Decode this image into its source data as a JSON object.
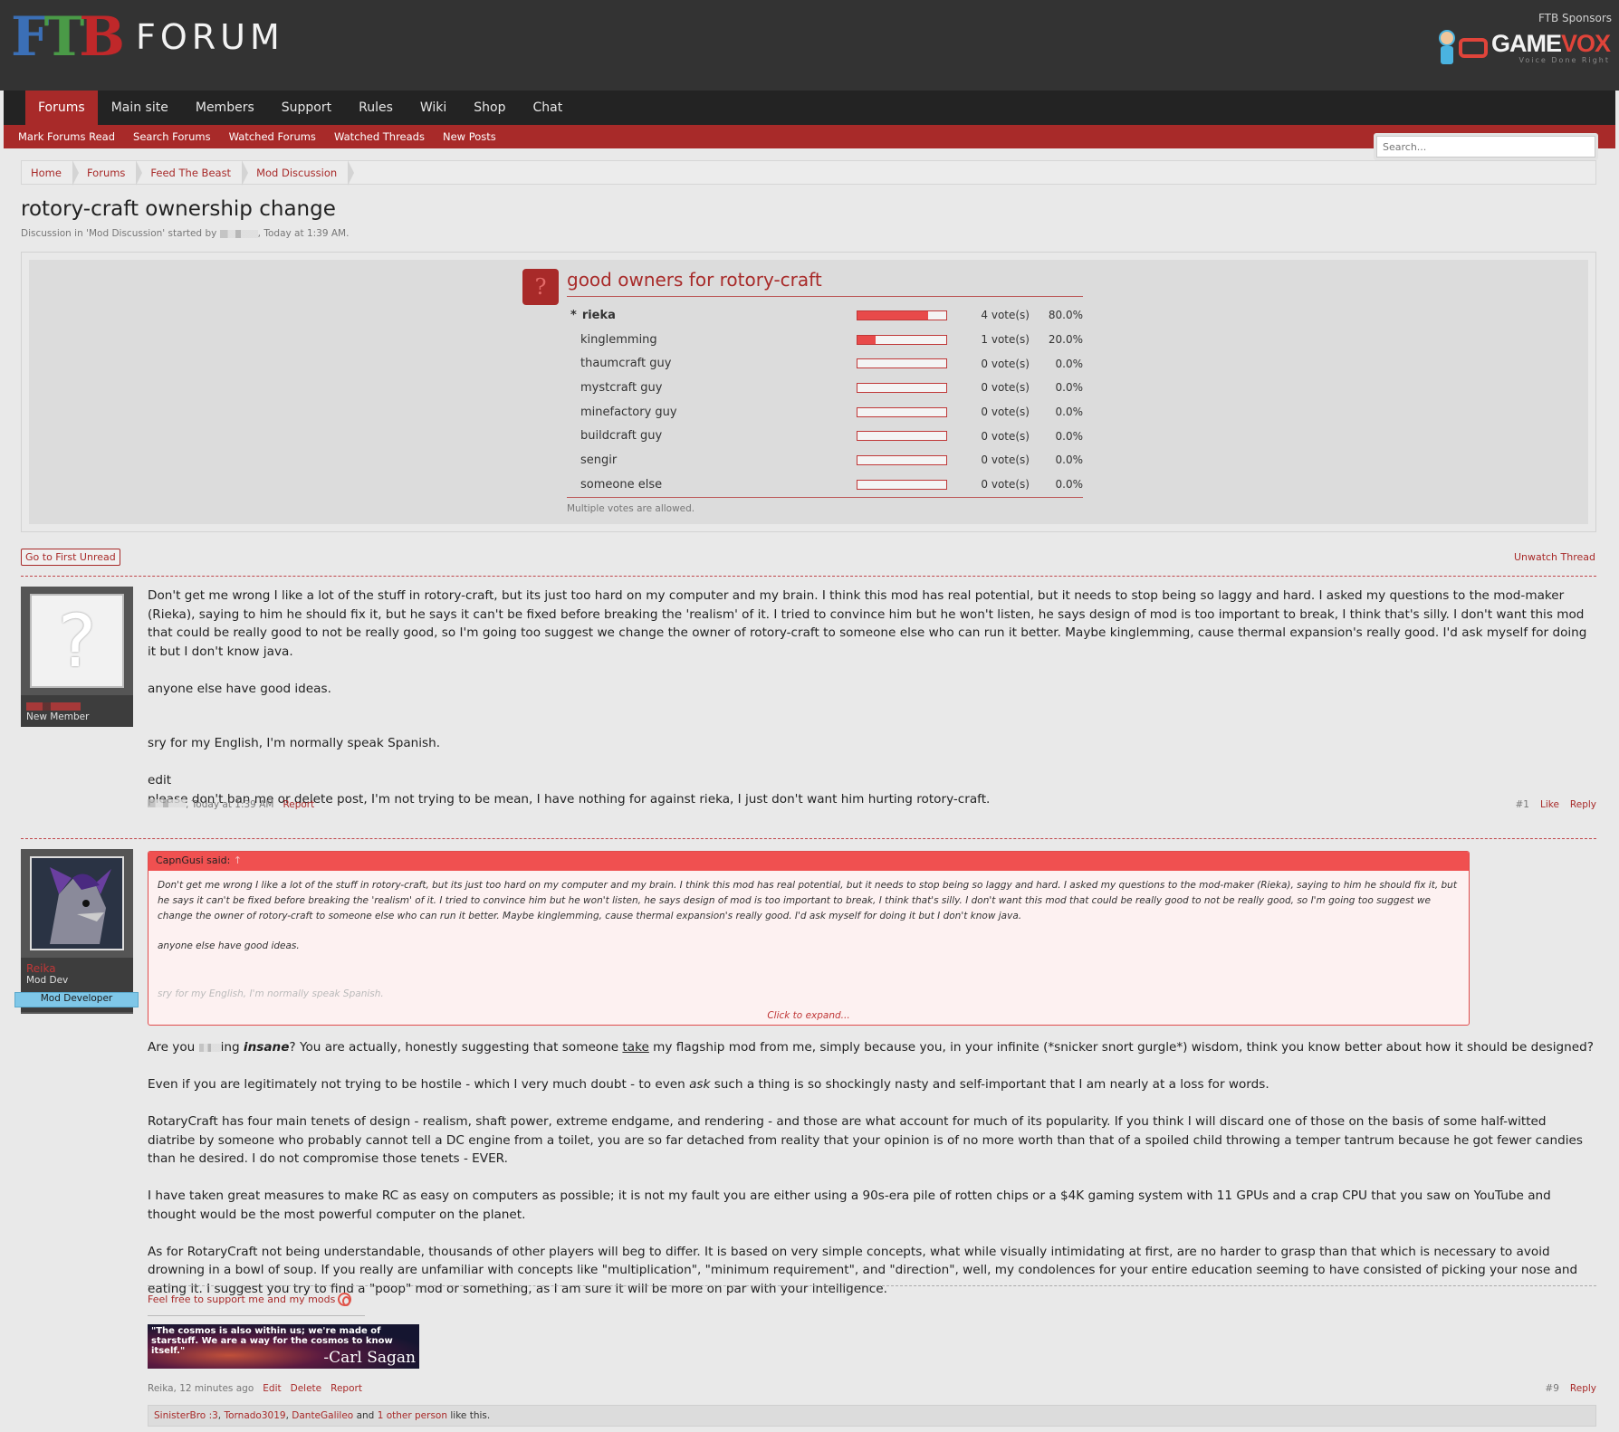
{
  "header": {
    "logo_mark": [
      "F",
      "T",
      "B"
    ],
    "logo_text": "FORUM",
    "sponsors_label": "FTB Sponsors",
    "sponsor_name_a": "GAME",
    "sponsor_name_b": "VOX",
    "sponsor_tagline": "Voice Done Right"
  },
  "nav": {
    "tabs": [
      "Forums",
      "Main site",
      "Members",
      "Support",
      "Rules",
      "Wiki",
      "Shop",
      "Chat"
    ],
    "active": "Forums",
    "sublinks": [
      "Mark Forums Read",
      "Search Forums",
      "Watched Forums",
      "Watched Threads",
      "New Posts"
    ],
    "search_placeholder": "Search..."
  },
  "breadcrumb": [
    "Home",
    "Forums",
    "Feed The Beast",
    "Mod Discussion"
  ],
  "thread": {
    "title": "rotory-craft ownership change",
    "meta_prefix": "Discussion in 'Mod Discussion' started by",
    "meta_suffix": ", Today at 1:39 AM."
  },
  "poll": {
    "question": "good owners for rotory-craft",
    "icon": "?",
    "options": [
      {
        "label": "rieka",
        "votes": "4 vote(s)",
        "percent": "80.0%",
        "fill": 0.8,
        "voted": true,
        "marker": "*"
      },
      {
        "label": "kinglemming",
        "votes": "1 vote(s)",
        "percent": "20.0%",
        "fill": 0.2,
        "voted": false
      },
      {
        "label": "thaumcraft guy",
        "votes": "0 vote(s)",
        "percent": "0.0%",
        "fill": 0,
        "voted": false
      },
      {
        "label": "mystcraft guy",
        "votes": "0 vote(s)",
        "percent": "0.0%",
        "fill": 0,
        "voted": false
      },
      {
        "label": "minefactory guy",
        "votes": "0 vote(s)",
        "percent": "0.0%",
        "fill": 0,
        "voted": false
      },
      {
        "label": "buildcraft guy",
        "votes": "0 vote(s)",
        "percent": "0.0%",
        "fill": 0,
        "voted": false
      },
      {
        "label": "sengir",
        "votes": "0 vote(s)",
        "percent": "0.0%",
        "fill": 0,
        "voted": false
      },
      {
        "label": "someone else",
        "votes": "0 vote(s)",
        "percent": "0.0%",
        "fill": 0,
        "voted": false
      }
    ],
    "footer": "Multiple votes are allowed."
  },
  "controls": {
    "first_unread": "Go to First Unread",
    "unwatch": "Unwatch Thread"
  },
  "post1": {
    "user_title": "New Member",
    "paragraphs": [
      "Don't get me wrong I like a lot of the stuff in rotory-craft, but its just too hard on my computer and my brain. I think this mod has real potential, but it needs to stop being so laggy and hard. I asked my questions to the mod-maker (Rieka), saying to him he should fix it, but he says it can't be fixed before breaking the 'realism' of it. I tried to convince him but he won't listen, he says design of mod is too important to break, I think that's silly. I don't want this mod that could be really good to not be really good, so I'm going too suggest we change the owner of rotory-craft to someone else who can run it better. Maybe kinglemming, cause thermal expansion's really good. I'd ask myself for doing it but I don't know java.",
      "anyone else have good ideas.",
      "sry for my English, I'm normally speak Spanish.",
      "edit",
      "please don't ban me or delete post, I'm not trying to be mean, I have nothing for against rieka, I just don't want him hurting rotory-craft."
    ],
    "time": ", Today at 1:39 AM",
    "report": "Report",
    "number": "#1",
    "like": "Like",
    "reply": "Reply"
  },
  "post2": {
    "username": "Reika",
    "user_title": "Mod Dev",
    "banner": "Mod Developer",
    "quote_author": "CapnGusi said:",
    "quote_arrow": "↑",
    "quote_paragraphs": [
      "Don't get me wrong I like a lot of the stuff in rotory-craft, but its just too hard on my computer and my brain. I think this mod has real potential, but it needs to stop being so laggy and hard. I asked my questions to the mod-maker (Rieka), saying to him he should fix it, but he says it can't be fixed before breaking the 'realism' of it. I tried to convince him but he won't listen, he says design of mod is too important to break, I think that's silly. I don't want this mod that could be really good to not be really good, so I'm going too suggest we change the owner of rotory-craft to someone else who can run it better. Maybe kinglemming, cause thermal expansion's really good. I'd ask myself for doing it but I don't know java.",
      "anyone else have good ideas.",
      "sry for my English, I'm normally speak Spanish."
    ],
    "quote_expand": "Click to expand...",
    "p1_a": "Are you ",
    "p1_b": "ing ",
    "p1_insane": "insane",
    "p1_c": "? You are actually, honestly suggesting that someone ",
    "p1_take": "take",
    "p1_d": " my flagship mod from me, simply because you, in your infinite (*snicker snort gurgle*) wisdom, think you know better about how it should be designed?",
    "p2_a": "Even if you are legitimately not trying to be hostile - which I very much doubt - to even ",
    "p2_ask": "ask",
    "p2_b": " such a thing is so shockingly nasty and self-important that I am nearly at a loss for words.",
    "p3": "RotaryCraft has four main tenets of design - realism, shaft power, extreme endgame, and rendering - and those are what account for much of its popularity. If you think I will discard one of those on the basis of some half-witted diatribe by someone who probably cannot tell a DC engine from a toilet, you are so far detached from reality that your opinion is of no more worth than that of a spoiled child throwing a temper tantrum because he got fewer candies than he desired. I do not compromise those tenets - EVER.",
    "p4": "I have taken great measures to make RC as easy on computers as possible; it is not my fault you are either using a 90s-era pile of rotten chips or a $4K gaming system with 11 GPUs and a crap CPU that you saw on YouTube and thought would be the most powerful computer on the planet.",
    "p5": "As for RotaryCraft not being understandable, thousands of other players will beg to differ. It is based on very simple concepts, what while visually intimidating at first, are no harder to grasp than that which is necessary to avoid drowning in a bowl of soup. If you really are unfamiliar with concepts like \"multiplication\", \"minimum requirement\", and \"direction\", well, my condolences for your entire education seeming to have consisted of picking your nose and eating it. I suggest you try to find a \"poop\" mod or something, as I am sure it will be more on par with your intelligence.",
    "signature_link": "Feel free to support me and my mods",
    "signature_quote": "\"The cosmos is also within us; we're made of starstuff. We are a way for the cosmos to know itself.\"",
    "signature_author": "-Carl Sagan",
    "meta": "Reika, 12 minutes ago",
    "edit": "Edit",
    "delete": "Delete",
    "report": "Report",
    "number": "#9",
    "reply": "Reply",
    "likers": [
      "SinisterBro :3",
      "Tornado3019",
      "DanteGalileo"
    ],
    "likes_and": "and",
    "likes_other": "1 other person",
    "likes_suffix": "like this."
  },
  "colors": {
    "accent": "#a82a29",
    "header_bg": "#333333",
    "nav_bg": "#232323",
    "bar_fill": "#e84a4a",
    "banner": "#7fc7e8"
  }
}
